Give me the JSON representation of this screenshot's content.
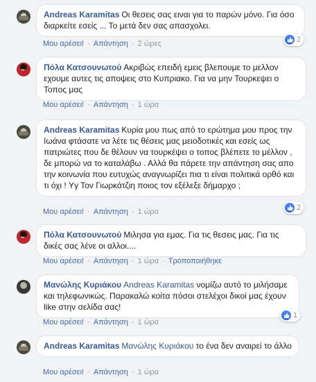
{
  "comments": [
    {
      "author": "Andreas Karamitas",
      "text": "Οι θεσεις σας ειναι για το παρών μόνο. Για όσο διαρκείτε εσείς ... Το μετά δεν σας απασχολει.",
      "like_label": "Μου αρέσει!",
      "reply_label": "Απάντηση",
      "time": "2 ώρες",
      "reactions": "2"
    },
    {
      "author": "Πόλα Κατσουνωτού",
      "text": "Ακριβώς επειδή εμεις βλεπουμε το μελλον εχουμε αυτες τις αποψεις στο Κυπριακο. Για να μην Τουρκεψει ο Τοπος μας",
      "like_label": "Μου αρέσει!",
      "reply_label": "Απάντηση",
      "time": "1 ώρα"
    },
    {
      "author": "Andreas Karamitas",
      "text": "Κυρία μου πως από το ερώτημα μου προς την Ιωάνα φτάσατε να λέτε τις θέσεις μας μειοδοτικές και εσείς ως πατριώτες που δε θέλουν να τουρκέψει ο τοπος βλέπετε το μέλλον , δε μπορώ να το καταλάβω . Αλλά θα πάρετε την απάντηση σας απο την κοινωνία που ευτυχώς αναγνωρίζει πια τι είναι πολιτικά ορθό και τι όχι ! Yγ Τον Γιωρκάτζιη ποιος τον εξέλεξε δήμαρχο ;",
      "like_label": "Μου αρέσει!",
      "reply_label": "Απάντηση",
      "time": "1 ώρα",
      "reactions": "2"
    },
    {
      "author": "Πόλα Κατσουνωτού",
      "text": "Μιλησα για εμας. Για τις θεσεις μας. Για τις δικές σας λένε οι αλλοι....",
      "like_label": "Μου αρέσει!",
      "reply_label": "Απάντηση",
      "time": "1 ώρα",
      "edited": "Τροποποιήθηκε"
    },
    {
      "author": "Μανώλης Κυριάκου",
      "mention": "Andreas Karamitas",
      "text": "νομίζω αυτό το μιλήσαμε και τηλεφωνικώς. Παρακαλώ κοίτα πόσοι στελέχοι δικοί μας έχουν like στην σελίδα σας!",
      "like_label": "Μου αρέσει!",
      "reply_label": "Απάντηση",
      "time": "1 ώρα",
      "reactions": "1"
    },
    {
      "author": "Andreas Karamitas",
      "mention": "Μανώλης Κυριάκου",
      "text": "το ένα δεν αναιρεί το άλλο",
      "like_label": "Μου αρέσει!",
      "reply_label": "Απάντηση",
      "time": "1 ώρα"
    }
  ],
  "colors": {
    "link": "#385898",
    "action": "#4267b2",
    "meta": "#90949c",
    "like": "#2a5fd6"
  },
  "icons": {
    "reaction": "thumbs-up-icon"
  }
}
